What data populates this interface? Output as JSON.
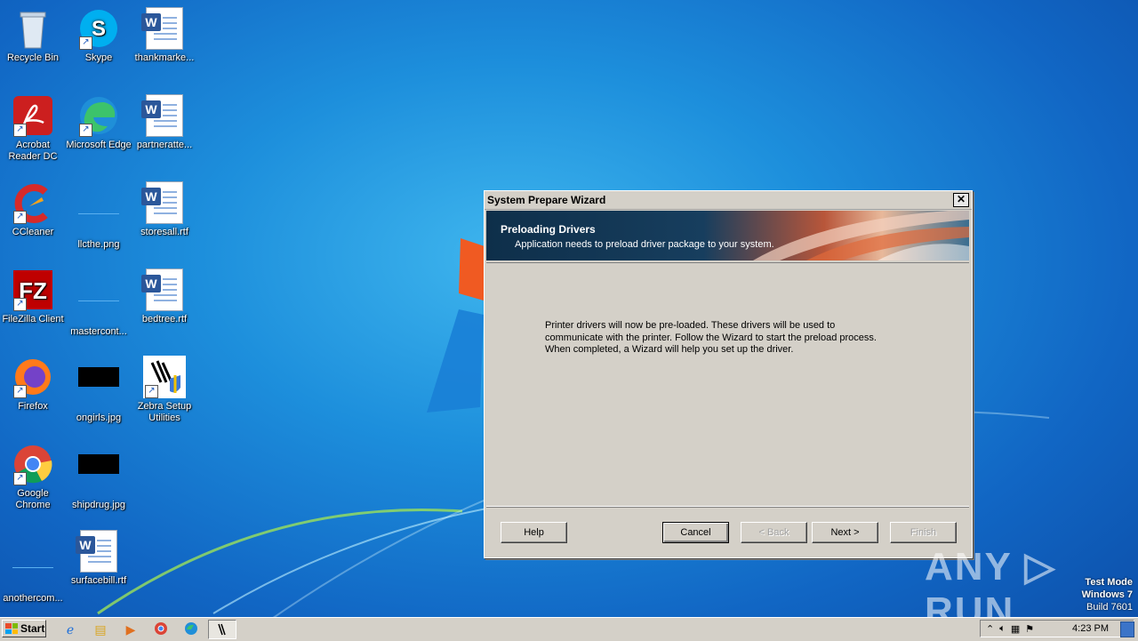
{
  "desktop": {
    "icons": [
      {
        "label": "Recycle Bin"
      },
      {
        "label": "Skype"
      },
      {
        "label": "thankmarke..."
      },
      {
        "label": "Acrobat Reader DC"
      },
      {
        "label": "Microsoft Edge"
      },
      {
        "label": "partneratte..."
      },
      {
        "label": "CCleaner"
      },
      {
        "label": "llcthe.png"
      },
      {
        "label": "storesall.rtf"
      },
      {
        "label": "FileZilla Client"
      },
      {
        "label": "mastercont..."
      },
      {
        "label": "bedtree.rtf"
      },
      {
        "label": "Firefox"
      },
      {
        "label": "ongirls.jpg"
      },
      {
        "label": "Zebra Setup Utilities"
      },
      {
        "label": "Google Chrome"
      },
      {
        "label": "shipdrug.jpg"
      },
      {
        "label": "anothercom..."
      },
      {
        "label": "surfacebill.rtf"
      }
    ]
  },
  "wizard": {
    "title": "System Prepare Wizard",
    "close_glyph": "✕",
    "header_title": "Preloading Drivers",
    "header_subtitle": "Application needs to preload driver package to your system.",
    "body": "Printer drivers will now be pre-loaded. These drivers will be used to communicate with the printer. Follow the Wizard to start the preload process. When completed, a Wizard will help you set up the driver.",
    "buttons": {
      "help": "Help",
      "cancel": "Cancel",
      "back": "< Back",
      "next": "Next >",
      "finish": "Finish"
    }
  },
  "taskbar": {
    "start_label": "Start",
    "clock": "4:23 PM"
  },
  "watermark": {
    "line1": "Test Mode",
    "line2": "Windows 7",
    "line3": "Build 7601"
  },
  "anyrun_text": "ANY ▷ RUN"
}
